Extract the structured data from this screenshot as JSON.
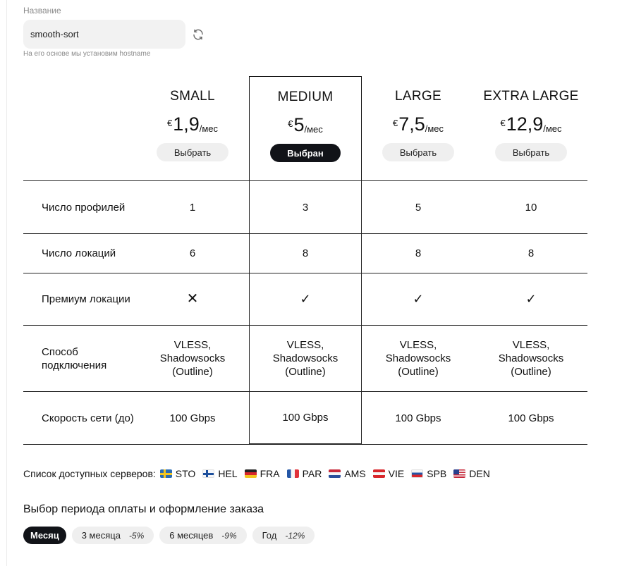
{
  "name_field": {
    "label": "Название",
    "value": "smooth-sort",
    "hint": "На его основе мы установим hostname"
  },
  "plans": [
    {
      "name": "SMALL",
      "currency": "€",
      "price": "1,9",
      "period": "/мес",
      "button": "Выбрать",
      "selected": false
    },
    {
      "name": "MEDIUM",
      "currency": "€",
      "price": "5",
      "period": "/мес",
      "button": "Выбран",
      "selected": true
    },
    {
      "name": "LARGE",
      "currency": "€",
      "price": "7,5",
      "period": "/мес",
      "button": "Выбрать",
      "selected": false
    },
    {
      "name": "EXTRA LARGE",
      "currency": "€",
      "price": "12,9",
      "period": "/мес",
      "button": "Выбрать",
      "selected": false
    }
  ],
  "features": [
    {
      "label": "Число профилей",
      "values": [
        "1",
        "3",
        "5",
        "10"
      ]
    },
    {
      "label": "Число локаций",
      "values": [
        "6",
        "8",
        "8",
        "8"
      ]
    },
    {
      "label": "Премиум локации",
      "values": [
        "✕",
        "✓",
        "✓",
        "✓"
      ]
    },
    {
      "label": "Способ подключения",
      "values": [
        "VLESS, Shadowsocks (Outline)",
        "VLESS, Shadowsocks (Outline)",
        "VLESS, Shadowsocks (Outline)",
        "VLESS, Shadowsocks (Outline)"
      ]
    },
    {
      "label": "Скорость сети (до)",
      "values": [
        "100 Gbps",
        "100 Gbps",
        "100 Gbps",
        "100 Gbps"
      ]
    }
  ],
  "servers": {
    "label": "Список доступных серверов:",
    "items": [
      {
        "code": "STO",
        "flag": "se"
      },
      {
        "code": "HEL",
        "flag": "fi"
      },
      {
        "code": "FRA",
        "flag": "de"
      },
      {
        "code": "PAR",
        "flag": "fr"
      },
      {
        "code": "AMS",
        "flag": "nl"
      },
      {
        "code": "VIE",
        "flag": "at"
      },
      {
        "code": "SPB",
        "flag": "ru"
      },
      {
        "code": "DEN",
        "flag": "us"
      }
    ]
  },
  "billing": {
    "title": "Выбор периода оплаты и оформление заказа",
    "periods": [
      {
        "label": "Месяц",
        "discount": "",
        "active": true
      },
      {
        "label": "3 месяца",
        "discount": "-5%",
        "active": false
      },
      {
        "label": "6 месяцев",
        "discount": "-9%",
        "active": false
      },
      {
        "label": "Год",
        "discount": "-12%",
        "active": false
      }
    ]
  },
  "colors": {
    "accent_dark": "#111318",
    "chip_bg": "#efefef",
    "input_bg": "#f2f2f2",
    "muted_text": "#8a8a8a"
  }
}
